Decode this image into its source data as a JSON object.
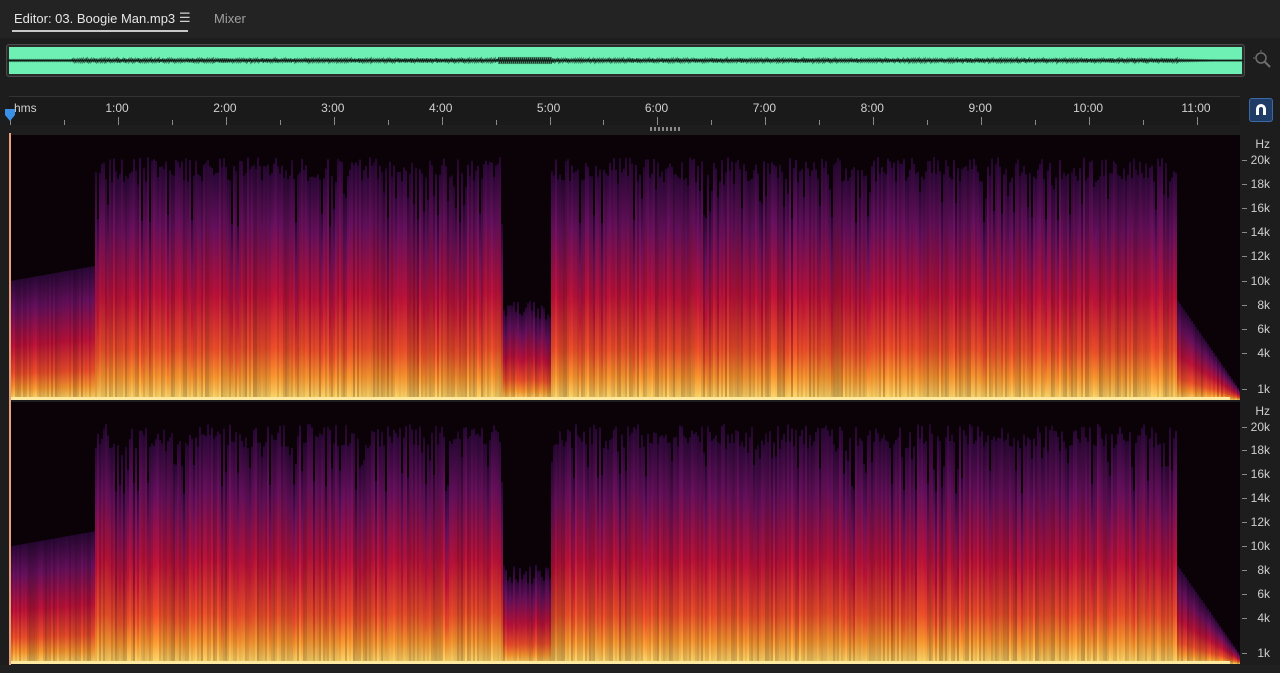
{
  "tabs": {
    "editor_label": "Editor: 03. Boogie Man.mp3",
    "menu_glyph": "☰",
    "mixer_label": "Mixer"
  },
  "ruler": {
    "unit_label": "hms",
    "time_labels": [
      "1:00",
      "2:00",
      "3:00",
      "4:00",
      "5:00",
      "6:00",
      "7:00",
      "8:00",
      "9:00",
      "10:00",
      "11:00"
    ]
  },
  "frequency_scale": {
    "unit_label": "Hz",
    "labels": [
      "20k",
      "18k",
      "16k",
      "14k",
      "12k",
      "10k",
      "8k",
      "6k",
      "4k",
      "1k"
    ]
  },
  "icons": {
    "zoom": "zoom-magnifier-icon",
    "snap": "snap-magnet-icon",
    "playhead": "playhead-marker-icon",
    "menu": "hamburger-menu-icon"
  },
  "colors": {
    "overview_waveform_bg": "#6ef0b4",
    "spectrogram_low": "#1a0420",
    "spectrogram_mid": "#c0103a",
    "spectrogram_high": "#ffd24a",
    "accent": "#3c6aa8"
  },
  "view_mode": "spectral-frequency-display",
  "channels": 2
}
